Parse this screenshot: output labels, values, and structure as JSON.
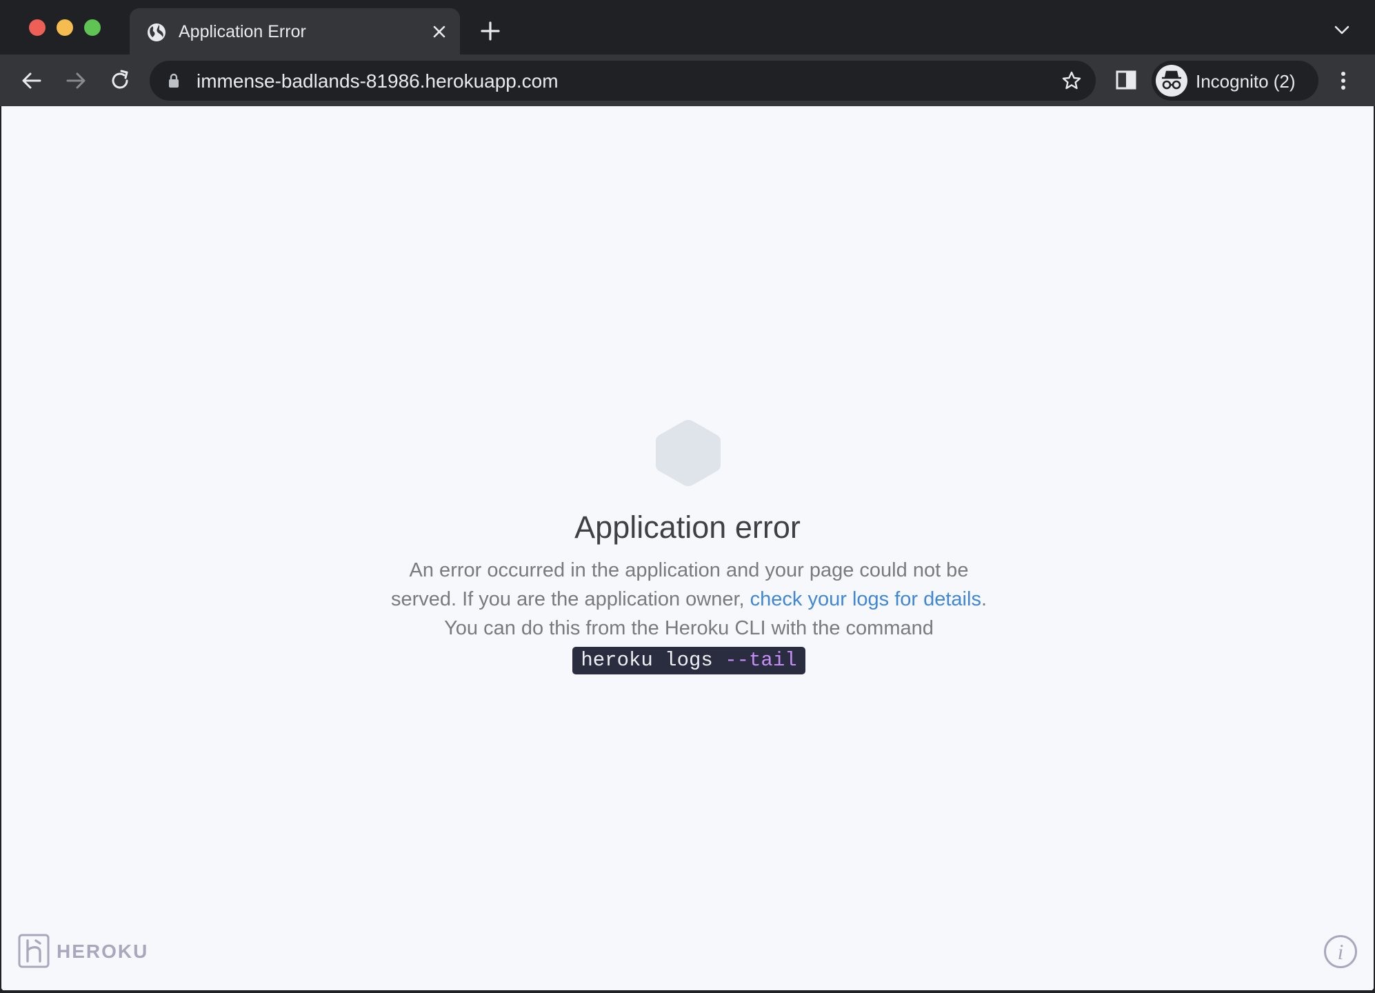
{
  "browser": {
    "tab": {
      "title": "Application Error",
      "icon": "globe-icon"
    },
    "address_bar": {
      "url": "immense-badlands-81986.herokuapp.com"
    },
    "profile": {
      "label": "Incognito (2)"
    }
  },
  "page": {
    "heading": "Application error",
    "body_line1": "An error occurred in the application and your page could not be served. If you are the application owner, ",
    "logs_link": "check your logs for details",
    "body_punct": ".",
    "body_line3": "You can do this from the Heroku CLI with the command",
    "command_main": "heroku logs ",
    "command_flag": "--tail",
    "brand": "HEROKU",
    "info_label": "i"
  },
  "colors": {
    "link": "#3f87d6",
    "command_bg": "#2a2c3f",
    "command_flag": "#c58df5",
    "page_bg": "#f7f8fb"
  }
}
